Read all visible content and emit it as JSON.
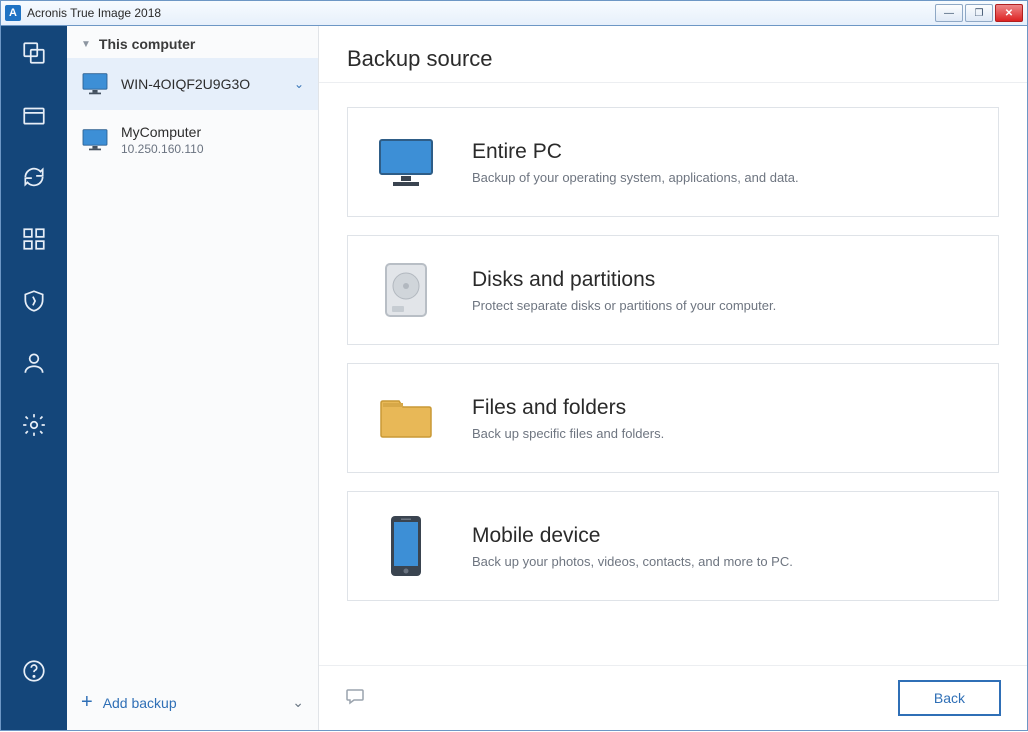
{
  "window": {
    "title": "Acronis True Image 2018",
    "app_letter": "A"
  },
  "sidebar": {
    "crumb": "This computer",
    "devices": [
      {
        "name": "WIN-4OIQF2U9G3O",
        "sub": "",
        "selected": true
      },
      {
        "name": "MyComputer",
        "sub": "10.250.160.110",
        "selected": false
      }
    ],
    "add_label": "Add backup"
  },
  "main": {
    "title": "Backup source",
    "options": [
      {
        "title": "Entire PC",
        "desc": "Backup of your operating system, applications, and data."
      },
      {
        "title": "Disks and partitions",
        "desc": "Protect separate disks or partitions of your computer."
      },
      {
        "title": "Files and folders",
        "desc": "Back up specific files and folders."
      },
      {
        "title": "Mobile device",
        "desc": "Back up your photos, videos, contacts, and more to PC."
      }
    ],
    "back_label": "Back"
  }
}
